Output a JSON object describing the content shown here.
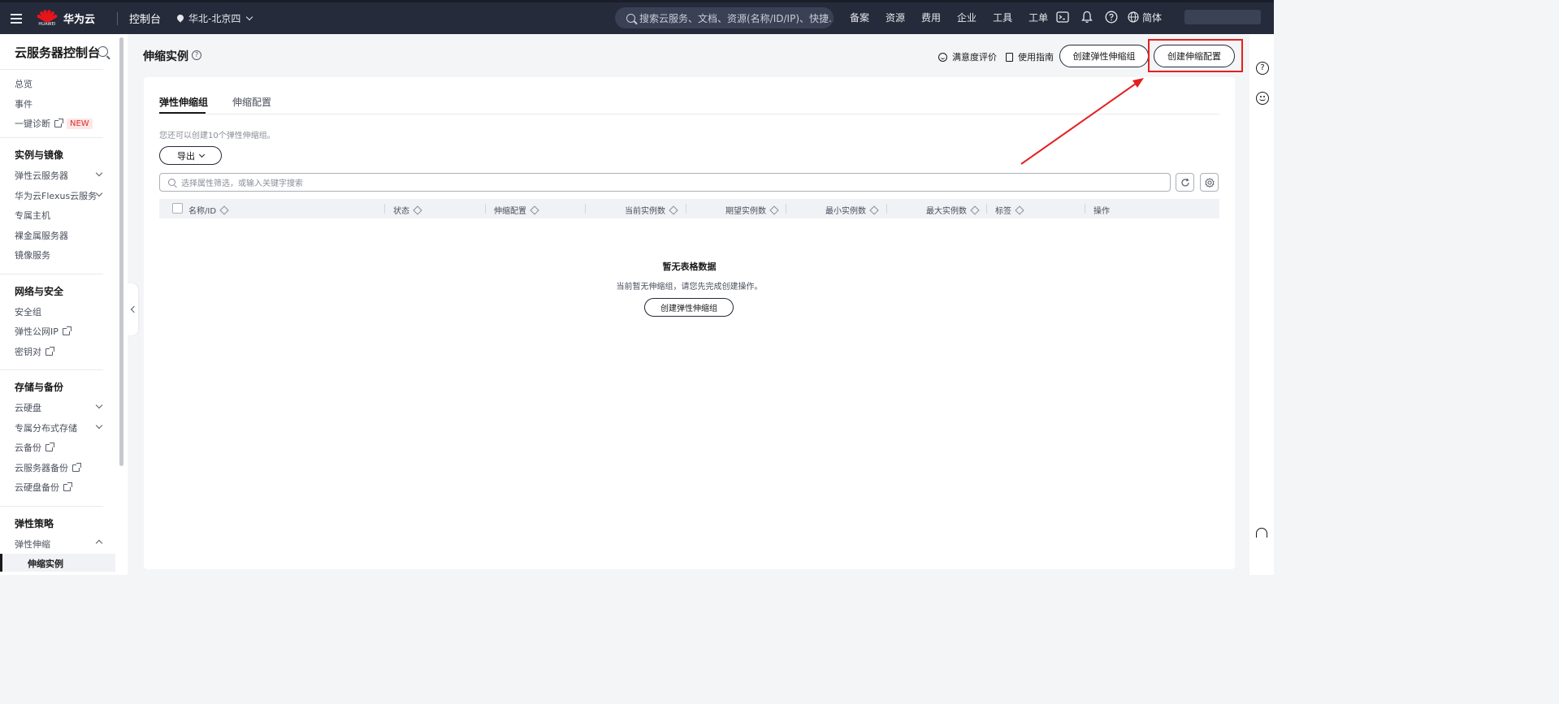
{
  "topnav": {
    "brand": "华为云",
    "logo_caption": "HUAWEI",
    "console": "控制台",
    "region": "华北-北京四",
    "search_placeholder": "搜索云服务、文档、资源(名称/ID/IP)、快捷...",
    "links": [
      "备案",
      "资源",
      "费用",
      "企业",
      "工具",
      "工单"
    ],
    "language": "简体"
  },
  "sidebar": {
    "title": "云服务器控制台",
    "top_items": [
      "总览",
      "事件",
      "一键诊断"
    ],
    "new_badge": "NEW",
    "groups": [
      {
        "title": "实例与镜像",
        "items": [
          "弹性云服务器",
          "华为云Flexus云服务",
          "专属主机",
          "裸金属服务器",
          "镜像服务"
        ]
      },
      {
        "title": "网络与安全",
        "items": [
          "安全组",
          "弹性公网IP",
          "密钥对"
        ]
      },
      {
        "title": "存储与备份",
        "items": [
          "云硬盘",
          "专属分布式存储",
          "云备份",
          "云服务器备份",
          "云硬盘备份"
        ]
      },
      {
        "title": "弹性策略",
        "items": [
          "弹性伸缩",
          "伸缩实例"
        ]
      }
    ]
  },
  "page": {
    "title": "伸缩实例",
    "help_glyph": "?",
    "satisfaction": "满意度评价",
    "guide": "使用指南",
    "btn_create_group": "创建弹性伸缩组",
    "btn_create_config": "创建伸缩配置"
  },
  "tabs": [
    "弹性伸缩组",
    "伸缩配置"
  ],
  "quota_text": "您还可以创建10个弹性伸缩组。",
  "export_label": "导出",
  "filter_placeholder": "选择属性筛选，或输入关键字搜索",
  "table": {
    "columns": [
      "名称/ID",
      "状态",
      "伸缩配置",
      "当前实例数",
      "期望实例数",
      "最小实例数",
      "最大实例数",
      "标签",
      "操作"
    ]
  },
  "empty": {
    "title": "暂无表格数据",
    "desc": "当前暂无伸缩组，请您先完成创建操作。",
    "button": "创建弹性伸缩组"
  },
  "rail": {
    "help_glyph": "?"
  },
  "colors": {
    "nav_bg": "#252b3a",
    "annotation_red": "#e32020",
    "brand_red": "#e7141a"
  }
}
